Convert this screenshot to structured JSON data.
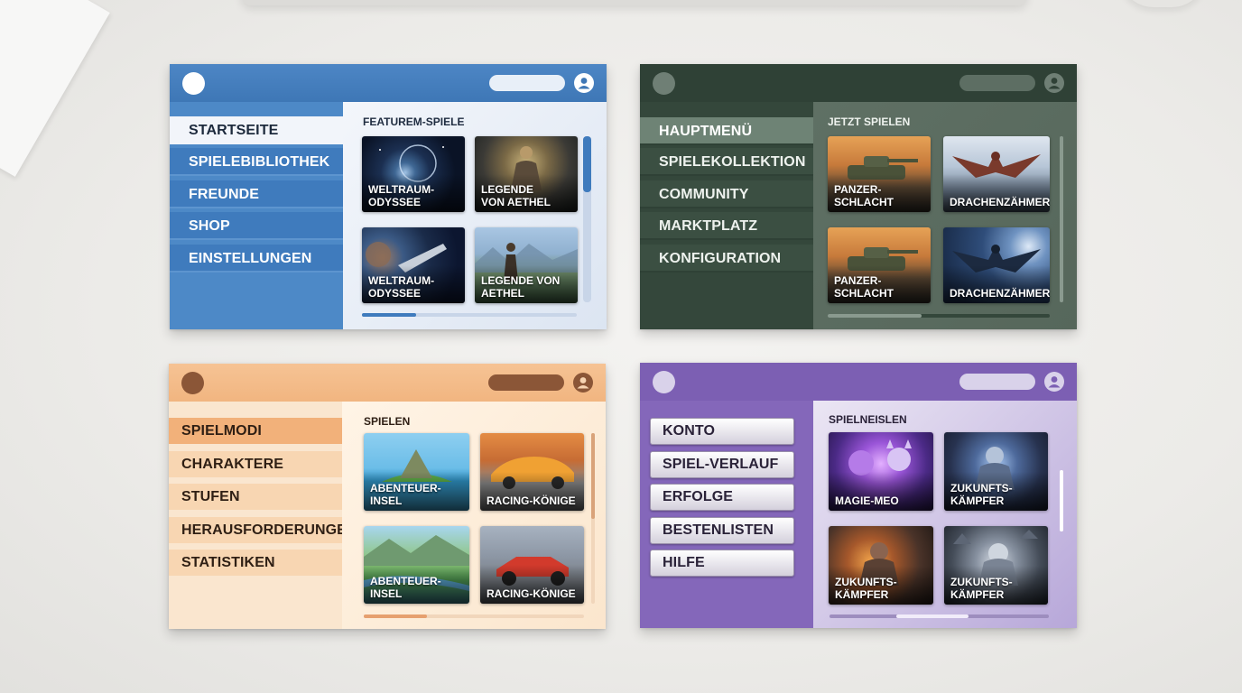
{
  "cards": {
    "blue": {
      "menu": [
        "STARTSEITE",
        "SPIELEBIBLIOTHEK",
        "FREUNDE",
        "SHOP",
        "EINSTELLUNGEN"
      ],
      "active_index": 0,
      "section_title": "FEATUREM-SPIELE",
      "tiles": [
        "WELTRAUM-\nODYSSEE",
        "LEGENDE\nVON AETHEL",
        "WELTRAUM-\nODYSSEE",
        "LEGENDE VON\nAETHEL"
      ],
      "vertical_scroll_fraction": 0.4,
      "horizontal_scroll_fraction": 0.25
    },
    "green": {
      "menu": [
        "HAUPTMENÜ",
        "SPIELEKOLLEKTION",
        "COMMUNITY",
        "MARKTPLATZ",
        "KONFIGURATION"
      ],
      "active_index": 0,
      "section_title": "JETZT SPIELEN",
      "tiles": [
        "PANZER-\nSCHLACHT",
        "DRACHENZÄHMER",
        "PANZER-\nSCHLACHT",
        "DRACHENZÄHMER"
      ],
      "vertical_scroll_fraction": 1.0,
      "horizontal_scroll_fraction": 0.4
    },
    "peach": {
      "menu": [
        "SPIELMODI",
        "CHARAKTERE",
        "STUFEN",
        "HERAUSFORDERUNGEN",
        "STATISTIKEN"
      ],
      "active_index": 0,
      "section_title": "SPIELEN",
      "tiles": [
        "ABENTEUER-INSEL",
        "RACING-KÖNIGE",
        "ABENTEUER-INSEL",
        "RACING-KÖNIGE"
      ],
      "vertical_scroll_fraction": 0.5,
      "horizontal_scroll_fraction": 0.28
    },
    "purple": {
      "menu": [
        "KONTO",
        "SPIEL-VERLAUF",
        "ERFOLGE",
        "BESTENLISTEN",
        "HILFE"
      ],
      "section_title": "SPIELNEISLEN",
      "tiles": [
        "MAGIE-MEO",
        "ZUKUNFTS-\nKÄMPFER",
        "ZUKUNFTS-\nKÄMPFER",
        "ZUKUNFTS-\nKÄMPFER"
      ],
      "vertical_scroll_fraction": 0.45,
      "horizontal_scroll_fraction": 0.33
    }
  },
  "icons": {
    "logo": "circle-logo-icon",
    "search": "search-pill",
    "avatar": "user-avatar-icon"
  },
  "colors": {
    "blue_accent": "#3f7bbd",
    "green_accent": "#34473b",
    "peach_accent": "#f2b17a",
    "purple_accent": "#7c5fb3"
  }
}
